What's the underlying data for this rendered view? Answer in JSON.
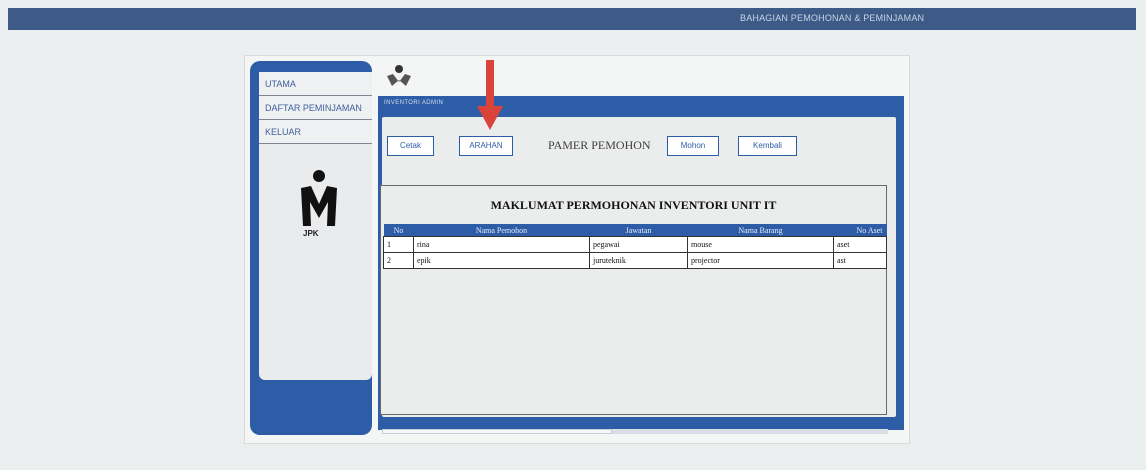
{
  "window": {
    "title": "BAHAGIAN PEMOHONAN & PEMINJAMAN"
  },
  "sidebar": {
    "items": [
      {
        "label": "UTAMA"
      },
      {
        "label": "DAFTAR PEMINJAMAN"
      },
      {
        "label": "KELUAR"
      }
    ],
    "logo_text": "JPK"
  },
  "header": {
    "nav_text": "INVENTORI ADMIN"
  },
  "toolbar": {
    "cetak": "Cetak",
    "arahan": "ARAHAN",
    "pamer": "PAMER PEMOHON",
    "mohon": "Mohon",
    "kembali": "Kembali"
  },
  "report": {
    "title": "MAKLUMAT PERMOHONAN INVENTORI UNIT IT",
    "columns": [
      "No",
      "Nama Pemohon",
      "Jawatan",
      "Nama Barang",
      "No Aset"
    ],
    "rows": [
      [
        "1",
        "rina",
        "pegawai",
        "mouse",
        "aset"
      ],
      [
        "2",
        "epik",
        "juruteknik",
        "projector",
        "ast"
      ]
    ]
  },
  "colors": {
    "brand_blue": "#2e5da7",
    "topbar": "#3d5b86",
    "arrow": "#d9433a"
  },
  "icons": [
    "app-logo-icon",
    "jpk-logo-icon",
    "annotation-arrow-icon"
  ]
}
